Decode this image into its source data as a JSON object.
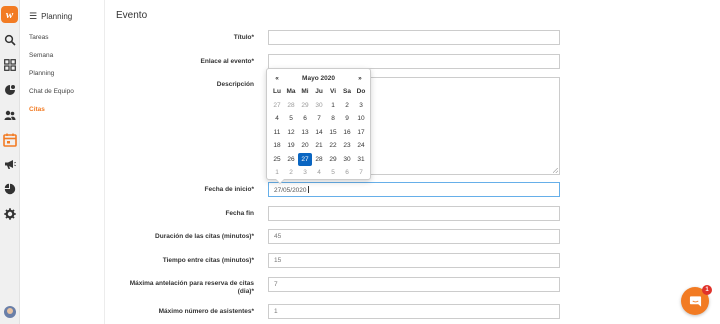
{
  "app": {
    "logo_letter": "w",
    "brand_color": "#f27b23",
    "accent_color": "#0a66c2"
  },
  "rail": {
    "icons": [
      "search-icon",
      "dashboard-icon",
      "clients-icon",
      "team-icon",
      "calendar-icon",
      "megaphone-icon",
      "chart-icon",
      "settings-icon",
      "avatar"
    ]
  },
  "sidebar": {
    "title": "Planning",
    "menu_icon": "hamburger-icon",
    "items": [
      {
        "label": "Tareas"
      },
      {
        "label": "Semana"
      },
      {
        "label": "Planning"
      },
      {
        "label": "Chat de Equipo"
      },
      {
        "label": "Citas",
        "active": true
      }
    ]
  },
  "main": {
    "title": "Evento"
  },
  "form": {
    "titulo": {
      "label": "Título*",
      "value": ""
    },
    "enlace": {
      "label": "Enlace al evento*",
      "value": ""
    },
    "descripcion": {
      "label": "Descripción",
      "value": ""
    },
    "fecha_inicio": {
      "label": "Fecha de inicio*",
      "value": "27/05/2020"
    },
    "fecha_fin": {
      "label": "Fecha fin",
      "value": ""
    },
    "duracion": {
      "label": "Duración de las citas (minutos)*",
      "value": "45"
    },
    "tiempo_entre": {
      "label": "Tiempo entre citas (minutos)*",
      "value": "15"
    },
    "antelacion": {
      "label_line1": "Máxima antelación para reserva de citas",
      "label_line2": "(dia)*",
      "value": "7"
    },
    "asistentes": {
      "label": "Máximo número de asistentes*",
      "value": "1"
    }
  },
  "datepicker": {
    "prev": "«",
    "next": "»",
    "month": "Mayo 2020",
    "weekdays": [
      "Lu",
      "Ma",
      "Mi",
      "Ju",
      "Vi",
      "Sa",
      "Do"
    ],
    "weeks": [
      [
        {
          "d": "27",
          "m": true
        },
        {
          "d": "28",
          "m": true
        },
        {
          "d": "29",
          "m": true
        },
        {
          "d": "30",
          "m": true
        },
        {
          "d": "1"
        },
        {
          "d": "2"
        },
        {
          "d": "3"
        }
      ],
      [
        {
          "d": "4"
        },
        {
          "d": "5"
        },
        {
          "d": "6"
        },
        {
          "d": "7"
        },
        {
          "d": "8"
        },
        {
          "d": "9"
        },
        {
          "d": "10"
        }
      ],
      [
        {
          "d": "11"
        },
        {
          "d": "12"
        },
        {
          "d": "13"
        },
        {
          "d": "14"
        },
        {
          "d": "15"
        },
        {
          "d": "16"
        },
        {
          "d": "17"
        }
      ],
      [
        {
          "d": "18"
        },
        {
          "d": "19"
        },
        {
          "d": "20"
        },
        {
          "d": "21"
        },
        {
          "d": "22"
        },
        {
          "d": "23"
        },
        {
          "d": "24"
        }
      ],
      [
        {
          "d": "25"
        },
        {
          "d": "26"
        },
        {
          "d": "27",
          "sel": true
        },
        {
          "d": "28"
        },
        {
          "d": "29"
        },
        {
          "d": "30"
        },
        {
          "d": "31"
        }
      ],
      [
        {
          "d": "1",
          "m": true
        },
        {
          "d": "2",
          "m": true
        },
        {
          "d": "3",
          "m": true
        },
        {
          "d": "4",
          "m": true
        },
        {
          "d": "5",
          "m": true
        },
        {
          "d": "6",
          "m": true
        },
        {
          "d": "7",
          "m": true
        }
      ]
    ]
  },
  "chat": {
    "icon": "chat-bubble-icon",
    "badge": "1"
  }
}
